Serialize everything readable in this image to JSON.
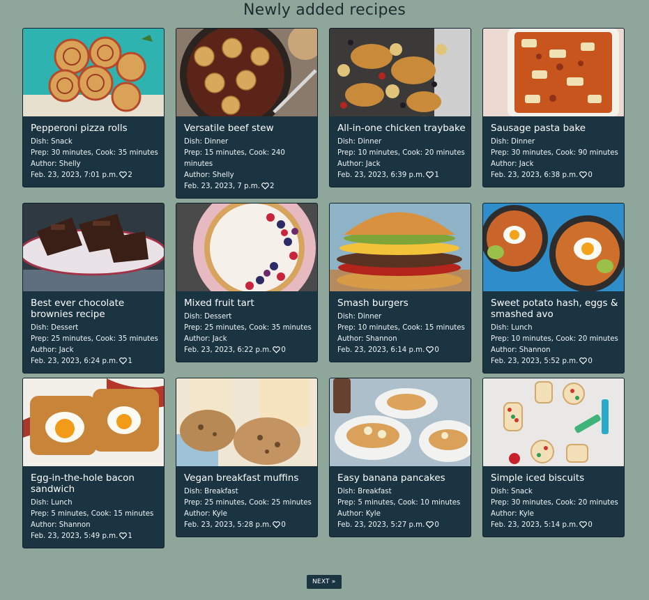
{
  "page": {
    "title": "Newly added recipes"
  },
  "recipes": [
    {
      "title": "Pepperoni pizza rolls",
      "dish": "Dish: Snack",
      "prep": "Prep: 30 minutes, Cook: 35 minutes",
      "author": "Author: Shelly",
      "date": "Feb. 23, 2023, 7:01 p.m.",
      "likes": "2",
      "image": "pizza-rolls-photo"
    },
    {
      "title": "Versatile beef stew",
      "dish": "Dish: Dinner",
      "prep": "Prep: 15 minutes, Cook: 240 minutes",
      "author": "Author: Shelly",
      "date": "Feb. 23, 2023, 7 p.m.",
      "likes": "2",
      "image": "beef-stew-photo"
    },
    {
      "title": "All-in-one chicken traybake",
      "dish": "Dish: Dinner",
      "prep": "Prep: 10 minutes, Cook: 20 minutes",
      "author": "Author: Jack",
      "date": "Feb. 23, 2023, 6:39 p.m.",
      "likes": "1",
      "image": "chicken-traybake-photo"
    },
    {
      "title": "Sausage pasta bake",
      "dish": "Dish: Dinner",
      "prep": "Prep: 30 minutes, Cook: 90 minutes",
      "author": "Author: Jack",
      "date": "Feb. 23, 2023, 6:38 p.m.",
      "likes": "0",
      "image": "pasta-bake-photo"
    },
    {
      "title": "Best ever chocolate brownies recipe",
      "dish": "Dish: Dessert",
      "prep": "Prep: 25 minutes, Cook: 35 minutes",
      "author": "Author: Jack",
      "date": "Feb. 23, 2023, 6:24 p.m.",
      "likes": "1",
      "image": "brownies-photo"
    },
    {
      "title": "Mixed fruit tart",
      "dish": "Dish: Dessert",
      "prep": "Prep: 25 minutes, Cook: 35 minutes",
      "author": "Author: Jack",
      "date": "Feb. 23, 2023, 6:22 p.m.",
      "likes": "0",
      "image": "fruit-tart-photo"
    },
    {
      "title": "Smash burgers",
      "dish": "Dish: Dinner",
      "prep": "Prep: 10 minutes, Cook: 15 minutes",
      "author": "Author: Shannon",
      "date": "Feb. 23, 2023, 6:14 p.m.",
      "likes": "0",
      "image": "burger-photo"
    },
    {
      "title": "Sweet potato hash, eggs & smashed avo",
      "dish": "Dish: Lunch",
      "prep": "Prep: 10 minutes, Cook: 20 minutes",
      "author": "Author: Shannon",
      "date": "Feb. 23, 2023, 5:52 p.m.",
      "likes": "0",
      "image": "potato-hash-photo"
    },
    {
      "title": "Egg-in-the-hole bacon sandwich",
      "dish": "Dish: Lunch",
      "prep": "Prep: 5 minutes, Cook: 15 minutes",
      "author": "Author: Shannon",
      "date": "Feb. 23, 2023, 5:49 p.m.",
      "likes": "1",
      "image": "egg-sandwich-photo"
    },
    {
      "title": "Vegan breakfast muffins",
      "dish": "Dish: Breakfast",
      "prep": "Prep: 25 minutes, Cook: 25 minutes",
      "author": "Author: Kyle",
      "date": "Feb. 23, 2023, 5:28 p.m.",
      "likes": "0",
      "image": "muffins-photo"
    },
    {
      "title": "Easy banana pancakes",
      "dish": "Dish: Breakfast",
      "prep": "Prep: 5 minutes, Cook: 10 minutes",
      "author": "Author: Kyle",
      "date": "Feb. 23, 2023, 5:27 p.m.",
      "likes": "0",
      "image": "pancakes-photo"
    },
    {
      "title": "Simple iced biscuits",
      "dish": "Dish: Snack",
      "prep": "Prep: 30 minutes, Cook: 20 minutes",
      "author": "Author: Kyle",
      "date": "Feb. 23, 2023, 5:14 p.m.",
      "likes": "0",
      "image": "biscuits-photo"
    }
  ],
  "pagination": {
    "next_label": "NEXT »"
  },
  "icons": {
    "like": "heart-outline-icon"
  },
  "colors": {
    "background": "#8fa79a",
    "card": "#1b3442",
    "text": "#ffffff"
  }
}
